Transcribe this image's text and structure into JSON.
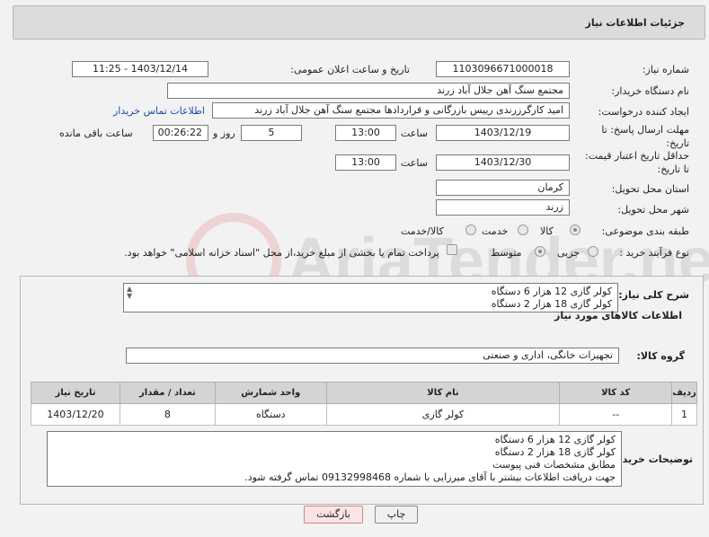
{
  "header": {
    "title": "جزئیات اطلاعات نیاز"
  },
  "fields": {
    "need_number_label": "شماره نیاز:",
    "need_number": "1103096671000018",
    "announce_label": "تاریخ و ساعت اعلان عمومی:",
    "announce_value": "1403/12/14 - 11:25",
    "buyer_label": "نام دستگاه خریدار:",
    "buyer_value": "مجتمع سنگ آهن جلال آباد زرند",
    "creator_label": "ایجاد کننده درخواست:",
    "creator_value": "امید کارگرزرندی رییس بازرگانی و قراردادها مجتمع سنگ آهن جلال آباد زرند",
    "contact_link": "اطلاعات تماس خریدار",
    "deadline_label": "مهلت ارسال پاسخ: تا تاریخ:",
    "deadline_date": "1403/12/19",
    "time_label": "ساعت",
    "deadline_time": "13:00",
    "days_value": "5",
    "days_label": "روز و",
    "remaining_value": "00:26:22",
    "remaining_label": "ساعت باقی مانده",
    "validity_label": "حداقل تاریخ اعتبار قیمت: تا تاریخ:",
    "validity_date": "1403/12/30",
    "validity_time": "13:00",
    "province_label": "استان محل تحویل:",
    "province_value": "کرمان",
    "city_label": "شهر محل تحویل:",
    "city_value": "زرند",
    "category_label": "طبقه بندی موضوعی:",
    "category_options": [
      "کالا",
      "خدمت",
      "کالا/خدمت"
    ],
    "process_label": "نوع فرآیند خرید :",
    "process_options": [
      "جزیی",
      "متوسط"
    ],
    "payment_note": "پرداخت تمام یا بخشی از مبلغ خرید،از محل \"اسناد خزانه اسلامی\" خواهد بود."
  },
  "summary": {
    "label": "شرح کلی نیاز:",
    "lines": [
      "کولر گازی 12 هزار 6 دستگاه",
      "کولر گازی 18 هزار  2 دستگاه"
    ]
  },
  "goods": {
    "section_title": "اطلاعات کالاهای مورد نیاز",
    "group_label": "گروه کالا:",
    "group_value": "تجهیزات خانگی، اداری و صنعتی",
    "columns": [
      "ردیف",
      "کد کالا",
      "نام کالا",
      "واحد شمارش",
      "تعداد / مقدار",
      "تاریخ نیاز"
    ],
    "rows": [
      [
        "1",
        "--",
        "کولر گازی",
        "دستگاه",
        "8",
        "1403/12/20"
      ]
    ]
  },
  "buyer_notes": {
    "label": "توضیحات خریدار:",
    "lines": [
      "کولر گازی 12 هزار 6 دستگاه",
      "کولر گازی 18 هزار  2 دستگاه",
      "مطابق مشخصات فنی پیوست",
      "جهت دریافت اطلاعات بیشتر با آقای میرزایی با شماره 09132998468 تماس گرفته شود."
    ]
  },
  "buttons": {
    "print": "چاپ",
    "back": "بازگشت"
  },
  "watermark": {
    "text": "AriaTender.neT"
  }
}
